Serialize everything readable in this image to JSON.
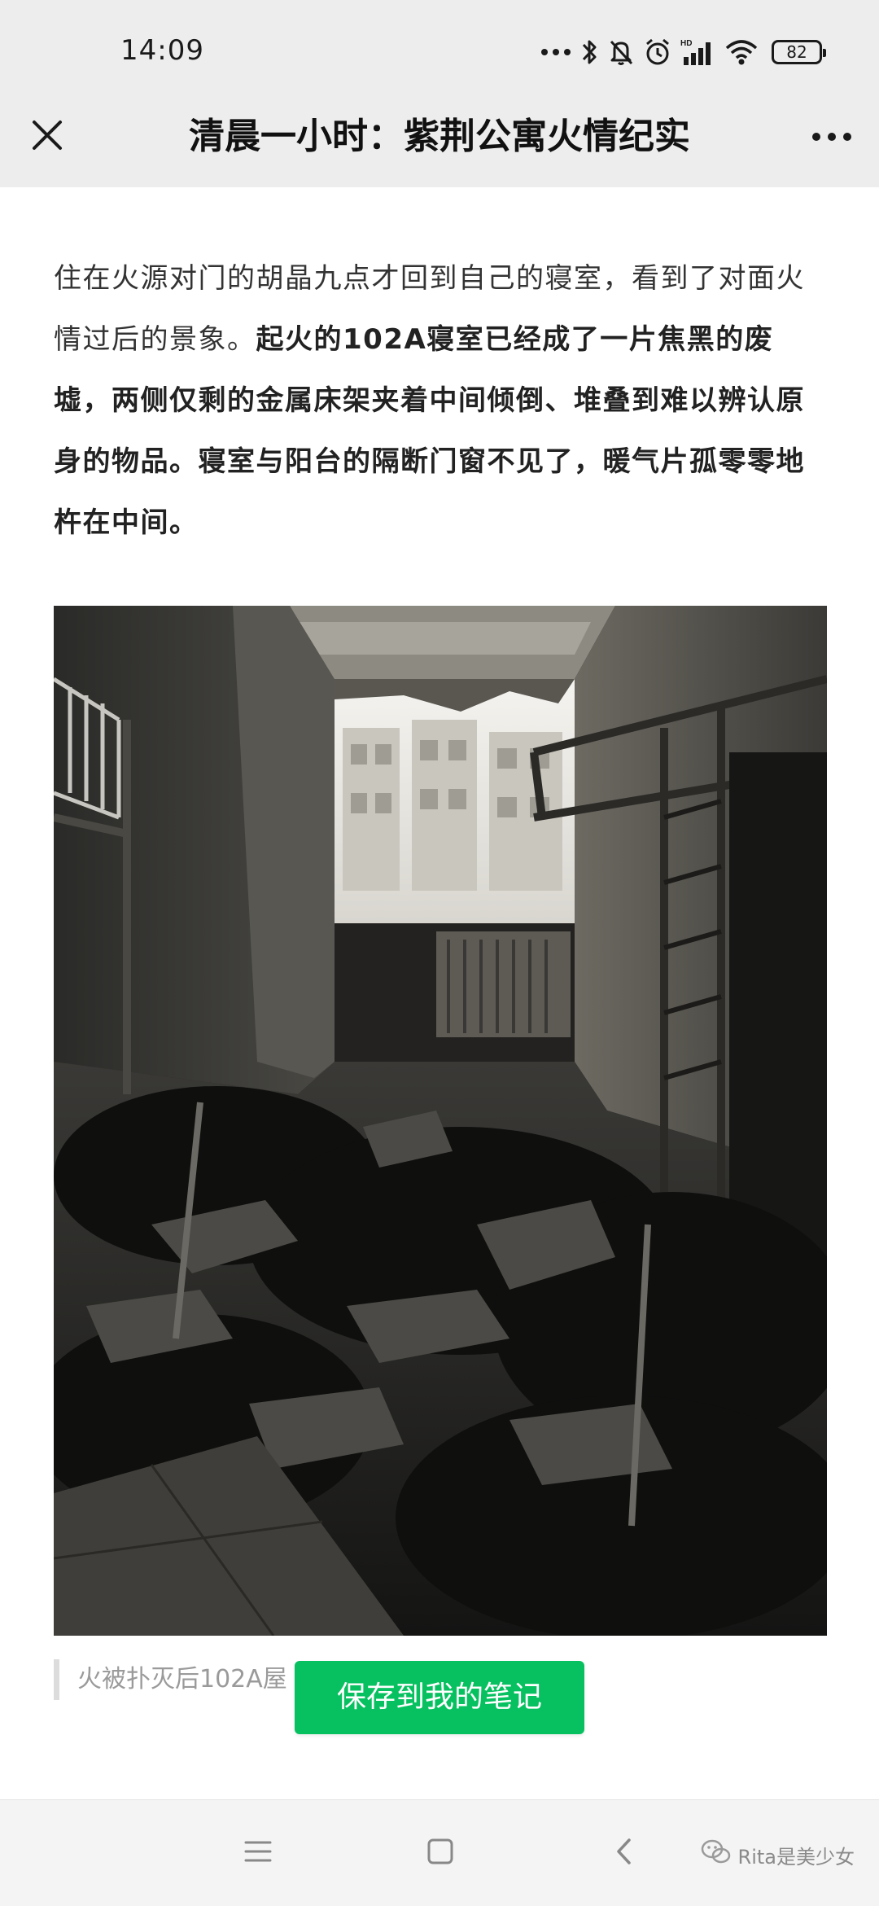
{
  "status_bar": {
    "time": "14:09",
    "battery": "82",
    "icons": [
      "more-dots-icon",
      "bluetooth-icon",
      "mute-bell-icon",
      "alarm-icon",
      "hd-signal-icon",
      "wifi-icon",
      "battery-icon"
    ]
  },
  "header": {
    "title": "清晨一小时：紫荆公寓火情纪实",
    "close_icon": "close-icon",
    "more_icon": "more-icon"
  },
  "article": {
    "paragraph_normal": "住在火源对门的胡晶九点才回到自己的寝室，看到了对面火情过后的景象。",
    "paragraph_bold": "起火的102A寝室已经成了一片焦黑的废墟，两侧仅剩的金属床架夹着中间倾倒、堆叠到难以辨认原身的物品。寝室与阳台的隔断门窗不见了，暖气片孤零零地杵在中间。"
  },
  "photo": {
    "subject": "burned dormitory room photo"
  },
  "caption": {
    "text": "火被扑灭后102A屋"
  },
  "save_button": {
    "label": "保存到我的笔记",
    "color": "#07c160"
  },
  "nav_bar": {
    "icons": [
      "menu-icon",
      "home-square-icon",
      "back-icon"
    ],
    "watermark": "Rita是美少女"
  }
}
